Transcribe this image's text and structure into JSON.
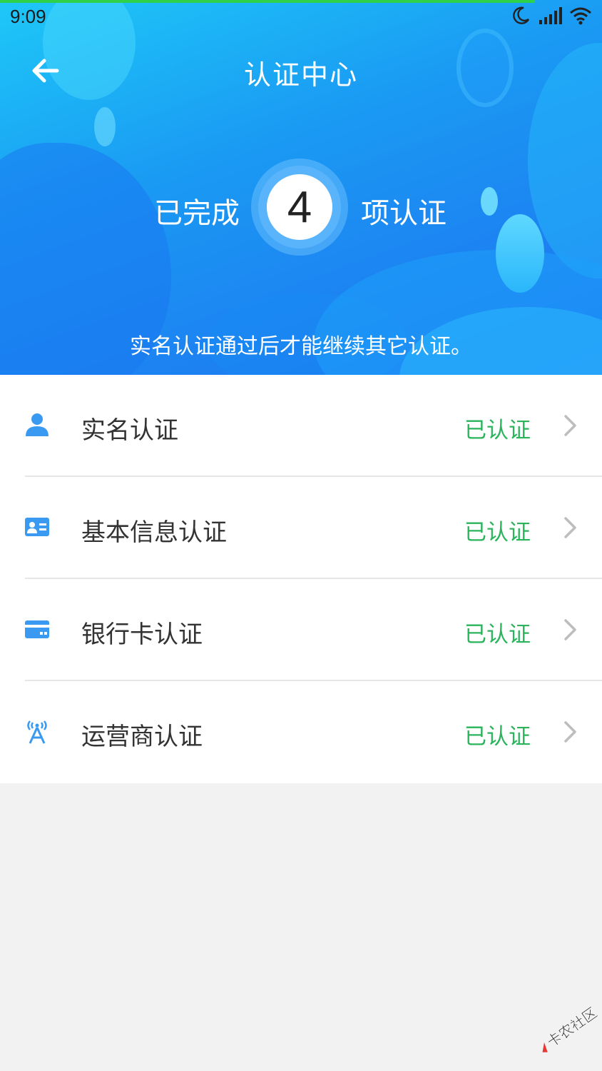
{
  "status_bar": {
    "time": "9:09"
  },
  "nav": {
    "title": "认证中心"
  },
  "summary": {
    "prefix": "已完成",
    "count": "4",
    "suffix": "项认证"
  },
  "hint": "实名认证通过后才能继续其它认证。",
  "colors": {
    "verified": "#2bb45c",
    "icon": "#3a9af2"
  },
  "items": [
    {
      "label": "实名认证",
      "status": "已认证",
      "icon": "user-icon"
    },
    {
      "label": "基本信息认证",
      "status": "已认证",
      "icon": "id-card-icon"
    },
    {
      "label": "银行卡认证",
      "status": "已认证",
      "icon": "bank-card-icon"
    },
    {
      "label": "运营商认证",
      "status": "已认证",
      "icon": "signal-tower-icon"
    }
  ],
  "watermark": "卡农社区"
}
